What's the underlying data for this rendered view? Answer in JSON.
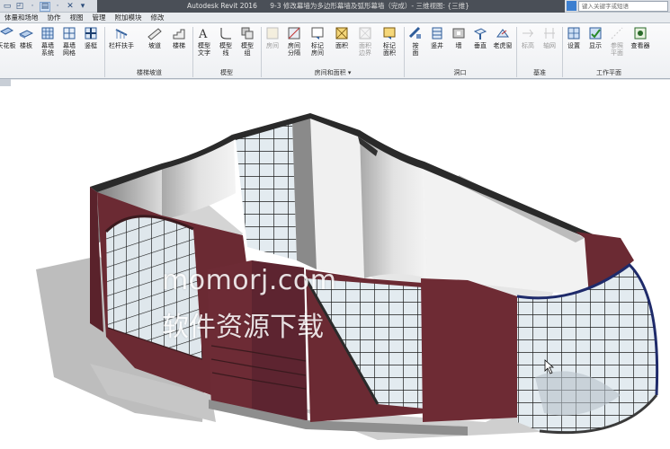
{
  "title_bar": {
    "app_name": "Autodesk Revit 2016",
    "document": "9-3 修改幕墙为多边形幕墙及弧形幕墙（完成）- 三维视图: {三维}",
    "search_placeholder": "键入关键字或短语"
  },
  "quick_access": {
    "open_icon": "open-file-icon",
    "save_icon": "save-icon",
    "view_icon": "view-icon",
    "close_icon": "close-icon"
  },
  "tabs": [
    "体量和场地",
    "协作",
    "视图",
    "管理",
    "附加模块",
    "修改"
  ],
  "ribbon": {
    "groups": [
      {
        "label": "",
        "buttons": [
          {
            "label": "天花板",
            "icon": "ceiling-icon"
          },
          {
            "label": "楼板",
            "icon": "floor-icon"
          },
          {
            "label": "幕墙\n系统",
            "icon": "curtain-system-icon"
          },
          {
            "label": "幕墙\n网格",
            "icon": "curtain-grid-icon"
          },
          {
            "label": "竖梃",
            "icon": "mullion-icon"
          }
        ]
      },
      {
        "label": "楼梯坡道",
        "buttons": [
          {
            "label": "栏杆扶手",
            "icon": "railing-icon"
          },
          {
            "label": "坡道",
            "icon": "ramp-icon"
          },
          {
            "label": "楼梯",
            "icon": "stair-icon"
          }
        ]
      },
      {
        "label": "模型",
        "buttons": [
          {
            "label": "模型\n文字",
            "icon": "model-text-icon"
          },
          {
            "label": "模型\n线",
            "icon": "model-line-icon"
          },
          {
            "label": "模型\n组",
            "icon": "model-group-icon"
          }
        ]
      },
      {
        "label": "房间和面积",
        "buttons": [
          {
            "label": "房间",
            "icon": "room-icon",
            "disabled": true
          },
          {
            "label": "房间\n分隔",
            "icon": "room-separator-icon"
          },
          {
            "label": "标记\n房间",
            "icon": "tag-room-icon"
          },
          {
            "label": "面积",
            "icon": "area-icon"
          },
          {
            "label": "面积\n边界",
            "icon": "area-boundary-icon",
            "disabled": true
          },
          {
            "label": "标记\n面积",
            "icon": "tag-area-icon"
          }
        ]
      },
      {
        "label": "洞口",
        "buttons": [
          {
            "label": "按\n面",
            "icon": "by-face-icon"
          },
          {
            "label": "竖井",
            "icon": "shaft-icon"
          },
          {
            "label": "墙",
            "icon": "wall-opening-icon"
          },
          {
            "label": "垂直",
            "icon": "vertical-icon"
          },
          {
            "label": "老虎窗",
            "icon": "dormer-icon"
          }
        ]
      },
      {
        "label": "基准",
        "buttons": [
          {
            "label": "标高",
            "icon": "level-icon",
            "disabled": true
          },
          {
            "label": "轴网",
            "icon": "grid-icon",
            "disabled": true
          }
        ]
      },
      {
        "label": "工作平面",
        "buttons": [
          {
            "label": "设置",
            "icon": "set-icon"
          },
          {
            "label": "显示",
            "icon": "show-icon"
          },
          {
            "label": "参照\n平面",
            "icon": "ref-plane-icon",
            "disabled": true
          },
          {
            "label": "查看器",
            "icon": "viewer-icon"
          }
        ]
      }
    ]
  },
  "watermark": {
    "line1": "momorj.com",
    "line2": "软件资源下载"
  },
  "colors": {
    "wall_exterior": "#6b2a33",
    "wall_top": "#c9c9c9",
    "glass": "#dfe8ee",
    "mullion": "#1a1a1a",
    "title_bar_dark": "#4a4f57"
  }
}
